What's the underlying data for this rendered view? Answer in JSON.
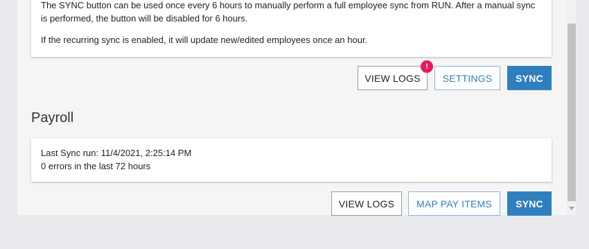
{
  "employee_sync": {
    "info_line1": "The SYNC button can be used once every 6 hours to manually perform a full employee sync from RUN. After a manual sync is performed, the button will be disabled for 6 hours.",
    "info_line2": "If the recurring sync is enabled, it will update new/edited employees once an hour.",
    "view_logs_label": "VIEW LOGS",
    "badge_text": "!",
    "settings_label": "SETTINGS",
    "sync_label": "SYNC"
  },
  "payroll": {
    "title": "Payroll",
    "last_sync": "Last Sync run: 11/4/2021, 2:25:14 PM",
    "errors": "0 errors in the last 72 hours",
    "view_logs_label": "VIEW LOGS",
    "map_pay_items_label": "MAP PAY ITEMS",
    "sync_label": "SYNC"
  },
  "colors": {
    "primary": "#2f7fbf",
    "badge": "#e8185a",
    "background": "#e9eaed"
  }
}
